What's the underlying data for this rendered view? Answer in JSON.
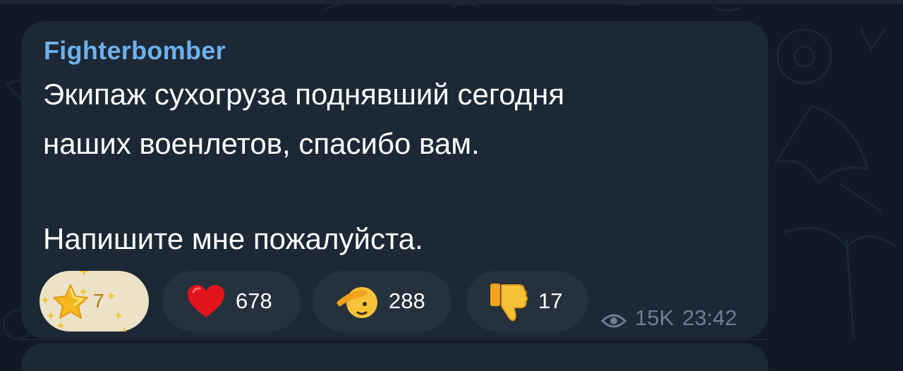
{
  "message": {
    "sender": "Fighterbomber",
    "lines": [
      "Экипаж сухогруза поднявший сегодня",
      "наших военлетов, спасибо вам.",
      "Напишите мне пожалуйста."
    ],
    "reactions": [
      {
        "icon": "star-icon",
        "count": "7"
      },
      {
        "icon": "heart-icon",
        "count": "678"
      },
      {
        "icon": "salute-icon",
        "count": "288"
      },
      {
        "icon": "thumbs-down-icon",
        "count": "17"
      }
    ],
    "views": "15K",
    "time": "23:42"
  },
  "colors": {
    "background": "#0f1a24",
    "bubble": "#1c2835",
    "sender": "#6fb0ea",
    "reaction_bg": "#26313e",
    "paid_reaction_bg": "#ece2c8",
    "meta": "#6f7f8f"
  }
}
